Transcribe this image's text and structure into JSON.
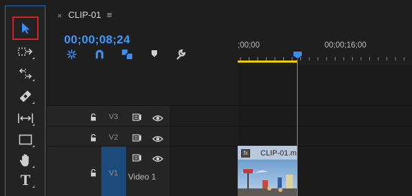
{
  "tools": [
    {
      "name": "selection-tool",
      "icon": "selection-arrow-icon",
      "active": true
    },
    {
      "name": "track-select-tool",
      "icon": "track-select-forward-icon"
    },
    {
      "name": "ripple-edit-tool",
      "icon": "ripple-edit-icon"
    },
    {
      "name": "razor-tool",
      "icon": "razor-icon"
    },
    {
      "name": "slip-tool",
      "icon": "slip-icon"
    },
    {
      "name": "rectangle-tool",
      "icon": "rectangle-icon"
    },
    {
      "name": "hand-tool",
      "icon": "hand-icon"
    },
    {
      "name": "type-tool",
      "icon": "type-icon",
      "glyph": "T"
    }
  ],
  "tab": {
    "close": "×",
    "title": "CLIP-01",
    "menu": "≡"
  },
  "timecode": "00;00;08;24",
  "ruler": {
    "labels": [
      ";00;00",
      "00;00;16;00"
    ],
    "in_out_fraction": 0.34
  },
  "tracks": [
    {
      "id": "V3",
      "label": "V3"
    },
    {
      "id": "V2",
      "label": "V2"
    },
    {
      "id": "V1",
      "label": "V1",
      "name": "Video 1"
    }
  ],
  "clip": {
    "name": "CLIP-01.m",
    "fx": "fx"
  },
  "colors": {
    "accent": "#3a9bff",
    "highlight": "#d6202a",
    "in_out": "#f0d000",
    "v1_target": "#1c4a7a"
  }
}
